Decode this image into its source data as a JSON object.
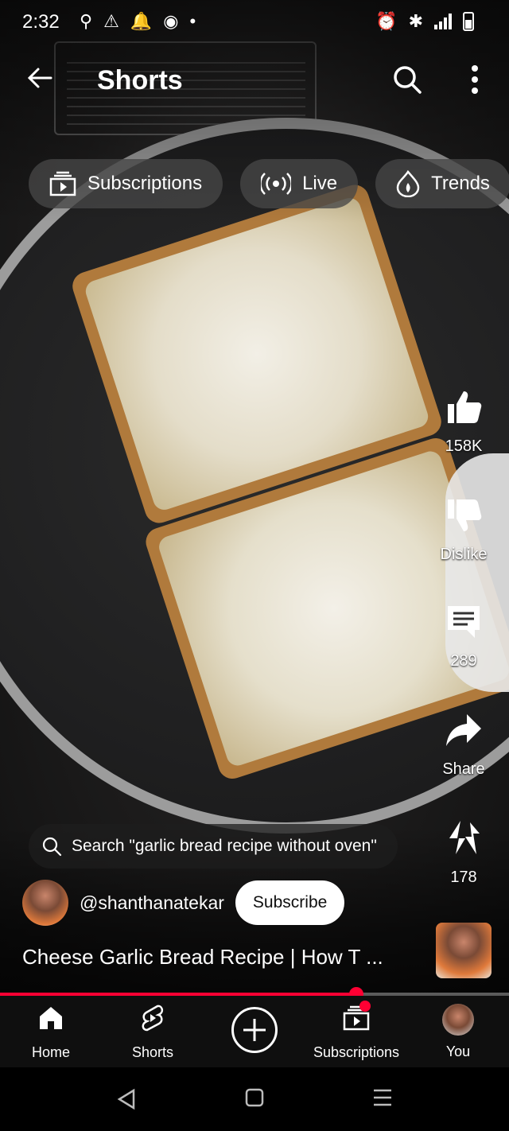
{
  "status_bar": {
    "time": "2:32"
  },
  "header": {
    "title": "Shorts"
  },
  "chips": [
    {
      "label": "Subscriptions",
      "icon": "subscriptions-icon"
    },
    {
      "label": "Live",
      "icon": "live-icon"
    },
    {
      "label": "Trends",
      "icon": "trends-icon"
    }
  ],
  "actions": {
    "like_count": "158K",
    "dislike_label": "Dislike",
    "comment_count": "289",
    "share_label": "Share",
    "remix_count": "178"
  },
  "search_suggestion": "Search \"garlic bread recipe without oven\"",
  "channel": {
    "handle": "@shanthanatekar",
    "subscribe_label": "Subscribe"
  },
  "video_title": "Cheese Garlic Bread Recipe | How T ...",
  "progress": 0.7,
  "bottom_nav": {
    "home": "Home",
    "shorts": "Shorts",
    "subscriptions": "Subscriptions",
    "you": "You"
  },
  "colors": {
    "accent": "#ff0033",
    "nav_bg": "#0f0f0f"
  }
}
